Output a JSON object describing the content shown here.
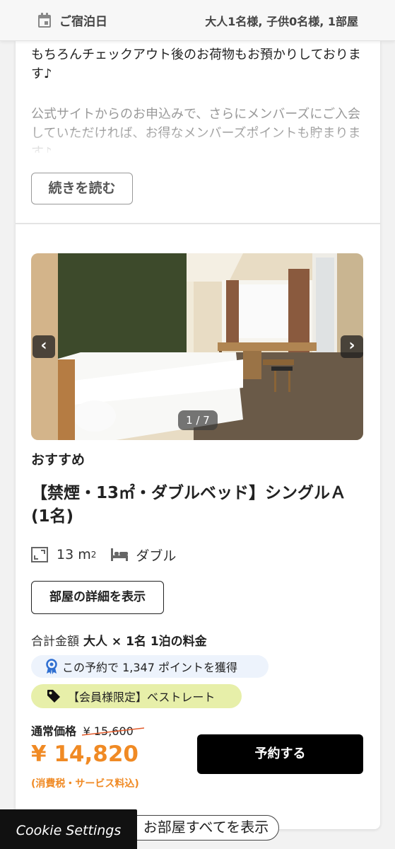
{
  "header": {
    "stay_label": "ご宿泊日",
    "guests": "大人1名様, 子供0名様, 1部屋",
    "calendar_icon": "calendar-icon"
  },
  "description": {
    "line1": "もちろんチェックアウト後のお荷物もお預かりしております♪",
    "line2": "公式サイトからのお申込みで、さらにメンバーズにご入会していただければ、お得なメンバーズポイントも貯まります♪",
    "read_more": "続きを読む"
  },
  "room": {
    "photo_counter": "1 / 7",
    "prev_icon": "chevron-left-icon",
    "next_icon": "chevron-right-icon",
    "tag": "おすすめ",
    "name": "【禁煙・13㎡・ダブルベッド】シングルＡ(1名)",
    "size_value": "13 m",
    "size_exp": "2",
    "bed_type": "ダブル",
    "details_button": "部屋の詳細を表示",
    "total_label": "合計金額",
    "total_detail": "大人 × 1名 1泊の料金",
    "points_text": "この予約で 1,347 ポイントを獲得",
    "rate_text": "【会員様限定】ベストレート",
    "regular_label": "通常価格",
    "regular_price": "¥ 15,600",
    "price": "¥ 14,820",
    "tax_note": "(消費税・サービス料込)",
    "book_button": "予約する"
  },
  "footer": {
    "show_all": "お部屋すべてを表示",
    "cookie_settings": "Cookie Settings"
  },
  "colors": {
    "price": "#f08a24",
    "points_bg": "#edf3fc",
    "rate_bg": "#e7efa9",
    "book_bg": "#000000"
  }
}
